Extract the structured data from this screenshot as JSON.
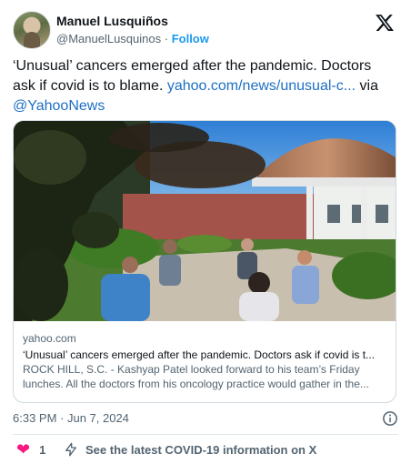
{
  "author": {
    "display_name": "Manuel Lusquiños",
    "handle": "@ManuelLusquinos",
    "separator": "·",
    "follow_label": "Follow"
  },
  "tweet": {
    "text_before_link": "‘Unusual’ cancers emerged after the pandemic. Doctors ask if covid is to blame. ",
    "link_text": "yahoo.com/news/unusual-c...",
    "text_via": " via ",
    "mention": "@YahooNews"
  },
  "link_card": {
    "domain": "yahoo.com",
    "title": "‘Unusual’ cancers emerged after the pandemic. Doctors ask if covid is t...",
    "description_line1": "ROCK HILL, S.C. - Kashyap Patel looked forward to his team’s Friday",
    "description_line2": "lunches. All the doctors from his oncology practice would gather in the..."
  },
  "meta": {
    "timestamp": "6:33 PM · Jun 7, 2024"
  },
  "actions": {
    "like_count": "1",
    "covid_info": "See the latest COVID-19 information on X"
  },
  "icons": {
    "logo": "x-logo-icon",
    "info": "info-icon",
    "like": "heart-icon",
    "covid": "lightning-bolt-icon"
  },
  "colors": {
    "link": "#1d6fc4",
    "follow": "#1d9bf0",
    "heart": "#f91880",
    "secondary_text": "#536471"
  }
}
